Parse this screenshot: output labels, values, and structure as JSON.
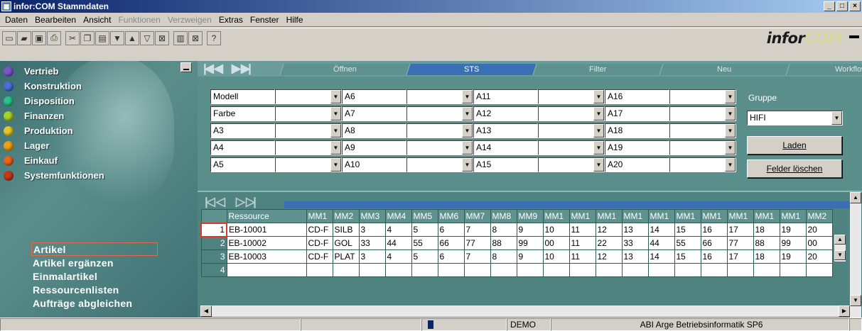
{
  "window": {
    "title": "infor:COM Stammdaten"
  },
  "menu": [
    "Daten",
    "Bearbeiten",
    "Ansicht",
    "Funktionen",
    "Verzweigen",
    "Extras",
    "Fenster",
    "Hilfe"
  ],
  "menu_disabled": [
    false,
    false,
    false,
    true,
    true,
    false,
    false,
    false
  ],
  "brand": {
    "part1": "infor",
    "part2": "COM"
  },
  "toolbar": {
    "icons": [
      "new-icon",
      "open-icon",
      "save-icon",
      "print-icon",
      "cut-icon",
      "copy-icon",
      "paste-icon",
      "move-down-icon",
      "move-up-icon",
      "filter-icon",
      "clear-filter-icon",
      "columns-icon",
      "rows-icon",
      "help-icon"
    ]
  },
  "modules": [
    {
      "label": "Vertrieb",
      "color": "#7a58c8"
    },
    {
      "label": "Konstruktion",
      "color": "#4a6fd8"
    },
    {
      "label": "Disposition",
      "color": "#27c28a"
    },
    {
      "label": "Finanzen",
      "color": "#a9d22a"
    },
    {
      "label": "Produktion",
      "color": "#e6c72a"
    },
    {
      "label": "Lager",
      "color": "#f0a018"
    },
    {
      "label": "Einkauf",
      "color": "#e8651a"
    },
    {
      "label": "Systemfunktionen",
      "color": "#c23a1a"
    }
  ],
  "submenu": [
    "Artikel",
    "Artikel ergänzen",
    "Einmalartikel",
    "Ressourcenlisten",
    "Aufträge abgleichen"
  ],
  "tabs": [
    "Öffnen",
    "STS",
    "Filter",
    "Neu",
    "Workflow"
  ],
  "active_tab": 1,
  "fields": [
    [
      "Modell",
      "A6",
      "A11",
      "A16"
    ],
    [
      "Farbe",
      "A7",
      "A12",
      "A17"
    ],
    [
      "A3",
      "A8",
      "A13",
      "A18"
    ],
    [
      "A4",
      "A9",
      "A14",
      "A19"
    ],
    [
      "A5",
      "A10",
      "A15",
      "A20"
    ]
  ],
  "group": {
    "label": "Gruppe",
    "value": "HIFI"
  },
  "buttons": {
    "load": "Laden",
    "clear": "Felder löschen"
  },
  "grid": {
    "columns": [
      "",
      "Ressource",
      "MM1",
      "MM2",
      "MM3",
      "MM4",
      "MM5",
      "MM6",
      "MM7",
      "MM8",
      "MM9",
      "MM1",
      "MM1",
      "MM1",
      "MM1",
      "MM1",
      "MM1",
      "MM1",
      "MM1",
      "MM1",
      "MM1",
      "MM2"
    ],
    "rows": [
      [
        "1",
        "EB-10001",
        "CD-F",
        "SILB",
        "3",
        "4",
        "5",
        "6",
        "7",
        "8",
        "9",
        "10",
        "11",
        "12",
        "13",
        "14",
        "15",
        "16",
        "17",
        "18",
        "19",
        "20"
      ],
      [
        "2",
        "EB-10002",
        "CD-F",
        "GOL",
        "33",
        "44",
        "55",
        "66",
        "77",
        "88",
        "99",
        "00",
        "11",
        "22",
        "33",
        "44",
        "55",
        "66",
        "77",
        "88",
        "99",
        "00"
      ],
      [
        "3",
        "EB-10003",
        "CD-F",
        "PLAT",
        "3",
        "4",
        "5",
        "6",
        "7",
        "8",
        "9",
        "10",
        "11",
        "12",
        "13",
        "14",
        "15",
        "16",
        "17",
        "18",
        "19",
        "20"
      ],
      [
        "4",
        "",
        "",
        "",
        "",
        "",
        "",
        "",
        "",
        "",
        "",
        "",
        "",
        "",
        "",
        "",
        "",
        "",
        "",
        "",
        "",
        ""
      ]
    ]
  },
  "status": {
    "mode": "DEMO",
    "company": "ABI Arge Betriebsinformatik SP6"
  }
}
